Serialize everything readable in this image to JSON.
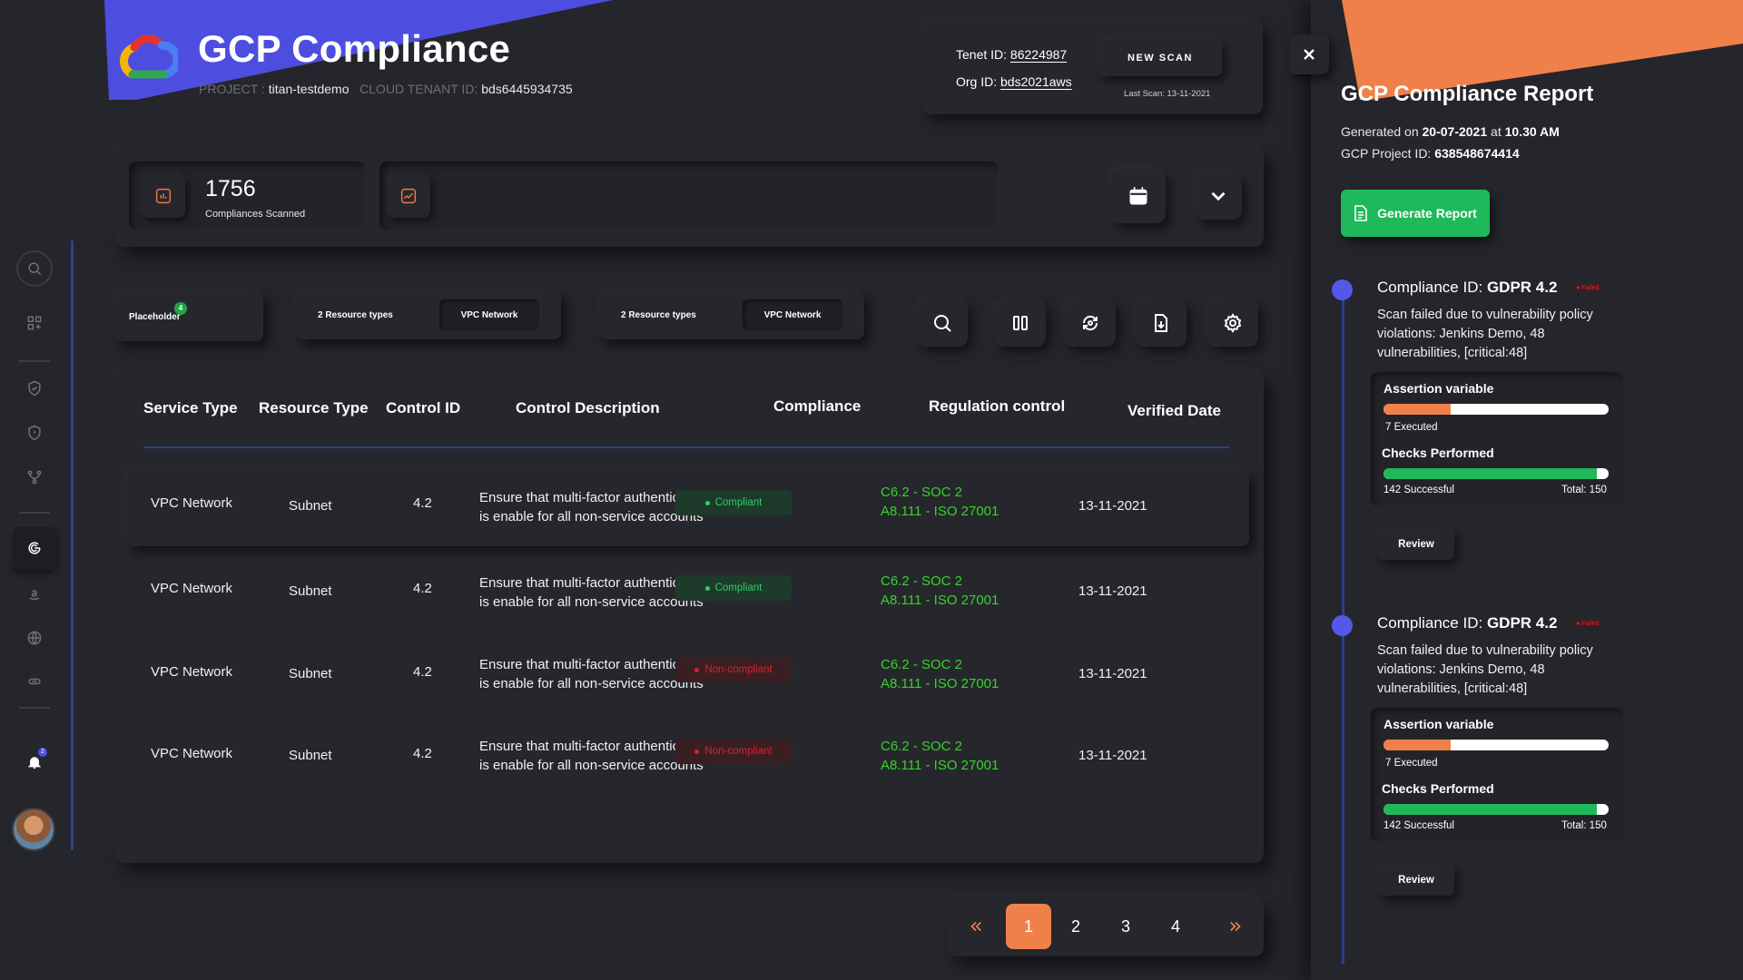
{
  "header": {
    "title": "GCP Compliance",
    "project_key": "PROJECT :",
    "project_value": "titan-testdemo",
    "tenant_key": "CLOUD TENANT ID:",
    "tenant_value": "bds6445934735"
  },
  "tenant_card": {
    "tenant_label": "Tenet ID:",
    "tenant_id": "86224987",
    "org_label": "Org ID:",
    "org_id": "bds2021aws",
    "new_scan_label": "NEW SCAN",
    "last_scan": "Last Scan: 13-11-2021"
  },
  "stats": {
    "count": "1756",
    "count_label": "Compliances Scanned"
  },
  "filters": [
    {
      "label": "Placeholder",
      "badge": "4"
    },
    {
      "label": "2 Resource types",
      "chip": "VPC Network"
    },
    {
      "label": "2 Resource types",
      "chip": "VPC Network"
    }
  ],
  "table": {
    "headers": [
      "Service Type",
      "Resource Type",
      "Control ID",
      "Control Description",
      "Compliance",
      "Regulation control",
      "Verified Date"
    ],
    "rows": [
      {
        "service": "VPC Network",
        "resource": "Subnet",
        "control_id": "4.2",
        "desc1": "Ensure that multi-factor authentication",
        "desc2": "is enable for all non-service accounts",
        "compliance": "Compliant",
        "reg1": "C6.2 - SOC 2",
        "reg2": "A8.111 - ISO 27001",
        "date": "13-11-2021"
      },
      {
        "service": "VPC Network",
        "resource": "Subnet",
        "control_id": "4.2",
        "desc1": "Ensure that multi-factor authentication",
        "desc2": "is enable for all non-service accounts",
        "compliance": "Compliant",
        "reg1": "C6.2 - SOC 2",
        "reg2": "A8.111 - ISO 27001",
        "date": "13-11-2021"
      },
      {
        "service": "VPC Network",
        "resource": "Subnet",
        "control_id": "4.2",
        "desc1": "Ensure that multi-factor authentication",
        "desc2": "is enable for all non-service accounts",
        "compliance": "Non-compliant",
        "reg1": "C6.2 - SOC 2",
        "reg2": "A8.111 - ISO 27001",
        "date": "13-11-2021"
      },
      {
        "service": "VPC Network",
        "resource": "Subnet",
        "control_id": "4.2",
        "desc1": "Ensure that multi-factor authentication",
        "desc2": "is enable for all non-service accounts",
        "compliance": "Non-compliant",
        "reg1": "C6.2 - SOC 2",
        "reg2": "A8.111 - ISO 27001",
        "date": "13-11-2021"
      }
    ]
  },
  "pagination": {
    "pages": [
      "1",
      "2",
      "3",
      "4"
    ],
    "current": "1"
  },
  "notifications": {
    "count": "2"
  },
  "report": {
    "title": "GCP Compliance Report",
    "generated_prefix": "Generated on",
    "generated_date": "20-07-2021",
    "at": "at",
    "generated_time": "10.30 AM",
    "project_label": "GCP Project ID:",
    "project_id": "638548674414",
    "generate_label": "Generate Report",
    "items": [
      {
        "title_prefix": "Compliance ID:",
        "title_id": "GDPR 4.2",
        "status": "Failed",
        "desc": "Scan failed due to vulnerability policy violations: Jenkins Demo, 48 vulnerabilities, [critical:48]",
        "assertion_label": "Assertion variable",
        "assertion_progress": 0.3,
        "executed": "7 Executed",
        "checks_label": "Checks Performed",
        "checks_progress": 0.947,
        "successful": "142 Successful",
        "total": "Total: 150",
        "review_label": "Review"
      },
      {
        "title_prefix": "Compliance ID:",
        "title_id": "GDPR 4.2",
        "status": "Failed",
        "desc": "Scan failed due to vulnerability policy violations: Jenkins Demo, 48 vulnerabilities, [critical:48]",
        "assertion_label": "Assertion variable",
        "assertion_progress": 0.3,
        "executed": "7 Executed",
        "checks_label": "Checks Performed",
        "checks_progress": 0.947,
        "successful": "142 Successful",
        "total": "Total: 150",
        "review_label": "Review"
      }
    ]
  },
  "colors": {
    "accent_orange": "#f0804a",
    "accent_blue": "#4d4ee0",
    "success_green": "#1fb85a",
    "regulation_green": "#35d42a",
    "danger_red": "#d5232b"
  }
}
